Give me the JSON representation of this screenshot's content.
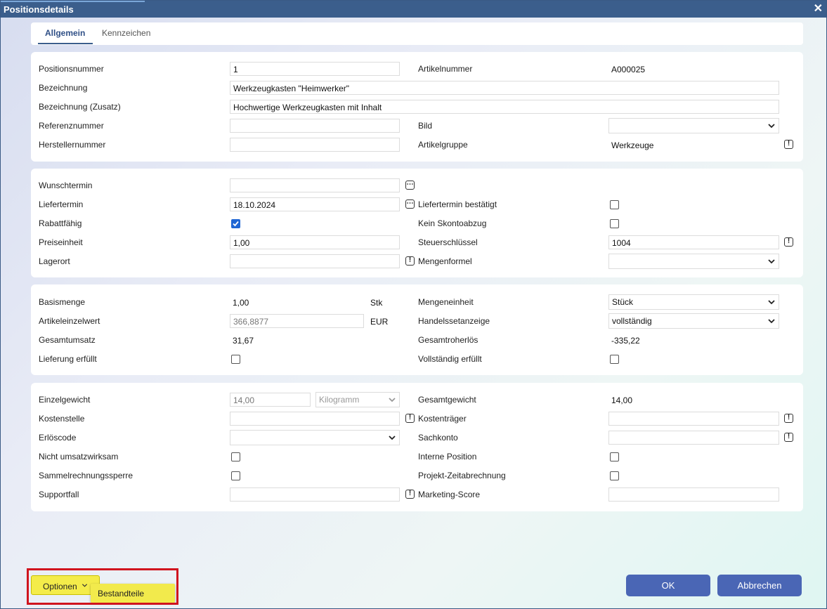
{
  "window": {
    "title": "Positionsdetails",
    "close_glyph": "✕"
  },
  "tabs": [
    {
      "label": "Allgemein"
    },
    {
      "label": "Kennzeichen"
    }
  ],
  "card1": {
    "positionsnummer": {
      "label": "Positionsnummer",
      "value": "1"
    },
    "artikelnummer": {
      "label": "Artikelnummer",
      "value": "A000025"
    },
    "bezeichnung": {
      "label": "Bezeichnung",
      "value": "Werkzeugkasten \"Heimwerker\""
    },
    "bezeichnung_zusatz": {
      "label": "Bezeichnung (Zusatz)",
      "value": "Hochwertige Werkzeugkasten mit Inhalt"
    },
    "referenznummer": {
      "label": "Referenznummer",
      "value": ""
    },
    "bild": {
      "label": "Bild",
      "value": ""
    },
    "herstellernummer": {
      "label": "Herstellernummer",
      "value": ""
    },
    "artikelgruppe": {
      "label": "Artikelgruppe",
      "value": "Werkzeuge"
    }
  },
  "card2": {
    "wunschtermin": {
      "label": "Wunschtermin",
      "value": ""
    },
    "liefertermin": {
      "label": "Liefertermin",
      "value": "18.10.2024"
    },
    "liefertermin_bestaetigt": {
      "label": "Liefertermin bestätigt",
      "checked": false
    },
    "rabattfaehig": {
      "label": "Rabattfähig",
      "checked": true
    },
    "kein_skontoabzug": {
      "label": "Kein Skontoabzug",
      "checked": false
    },
    "preiseinheit": {
      "label": "Preiseinheit",
      "value": "1,00"
    },
    "steuerschluessel": {
      "label": "Steuerschlüssel",
      "value": "1004"
    },
    "lagerort": {
      "label": "Lagerort",
      "value": ""
    },
    "mengenformel": {
      "label": "Mengenformel",
      "value": ""
    }
  },
  "card3": {
    "basismenge": {
      "label": "Basismenge",
      "value": "1,00",
      "unit": "Stk"
    },
    "mengeneinheit": {
      "label": "Mengeneinheit",
      "value": "Stück"
    },
    "artikeleinzelwert": {
      "label": "Artikeleinzelwert",
      "value": "366,8877",
      "unit": "EUR"
    },
    "handelssetanzeige": {
      "label": "Handelssetanzeige",
      "value": "vollständig"
    },
    "gesamtumsatz": {
      "label": "Gesamtumsatz",
      "value": "31,67"
    },
    "gesamtroherloes": {
      "label": "Gesamtroherlös",
      "value": "-335,22"
    },
    "lieferung_erfuellt": {
      "label": "Lieferung erfüllt",
      "checked": false
    },
    "vollstaendig_erfuellt": {
      "label": "Vollständig erfüllt",
      "checked": false
    }
  },
  "card4": {
    "einzelgewicht": {
      "label": "Einzelgewicht",
      "value": "14,00",
      "unit_select": "Kilogramm"
    },
    "gesamtgewicht": {
      "label": "Gesamtgewicht",
      "value": "14,00"
    },
    "kostenstelle": {
      "label": "Kostenstelle",
      "value": ""
    },
    "kostentraeger": {
      "label": "Kostenträger",
      "value": ""
    },
    "erloescode": {
      "label": "Erlöscode",
      "value": ""
    },
    "sachkonto": {
      "label": "Sachkonto",
      "value": ""
    },
    "nicht_umsatzwirksam": {
      "label": "Nicht umsatzwirksam",
      "checked": false
    },
    "interne_position": {
      "label": "Interne Position",
      "checked": false
    },
    "sammelrechnungssperre": {
      "label": "Sammelrechnungssperre",
      "checked": false
    },
    "projekt_zeitabrechnung": {
      "label": "Projekt-Zeitabrechnung",
      "checked": false
    },
    "supportfall": {
      "label": "Supportfall",
      "value": ""
    },
    "marketing_score": {
      "label": "Marketing-Score",
      "value": ""
    }
  },
  "footer": {
    "options_label": "Optionen",
    "options_menu": [
      "Bestandteile"
    ],
    "ok_label": "OK",
    "cancel_label": "Abbrechen"
  },
  "icons": {
    "ellipsis": "⋯",
    "info": "!"
  },
  "colors": {
    "titlebar": "#3b5e8c",
    "primary_button": "#4a66b5",
    "options_button": "#f4ec4a",
    "highlight_border": "#d0141e",
    "checkbox_checked": "#1f66d4"
  }
}
